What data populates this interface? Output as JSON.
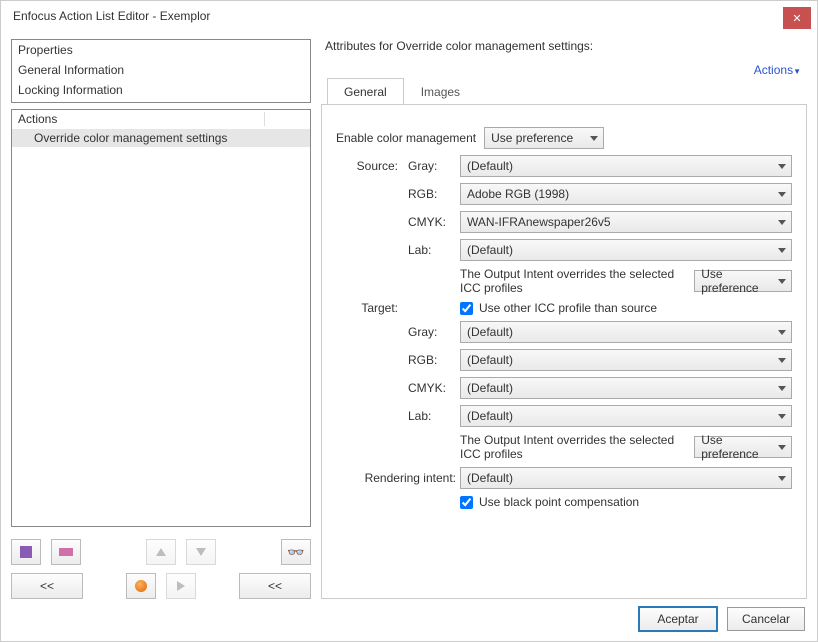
{
  "window": {
    "title": "Enfocus Action List Editor - Exemplor"
  },
  "left": {
    "list1": {
      "items": [
        "Properties",
        "General Information",
        "Locking Information"
      ]
    },
    "list2": {
      "header": "Actions",
      "items": [
        "Override color management settings"
      ]
    }
  },
  "right": {
    "title": "Attributes for Override color management settings:",
    "actions_link": "Actions",
    "tabs": {
      "general": "General",
      "images": "Images"
    },
    "form": {
      "enable_label": "Enable color management",
      "enable_value": "Use preference",
      "source_label": "Source:",
      "target_label": "Target:",
      "rendering_label": "Rendering intent:",
      "sub": {
        "gray": "Gray:",
        "rgb": "RGB:",
        "cmyk": "CMYK:",
        "lab": "Lab:"
      },
      "source": {
        "gray": "(Default)",
        "rgb": "Adobe RGB (1998)",
        "cmyk": "WAN-IFRAnewspaper26v5",
        "lab": "(Default)"
      },
      "output_intent_text": "The Output Intent overrides the selected ICC profiles",
      "output_intent_value_src": "Use preference",
      "use_other_label": "Use other ICC profile than source",
      "target": {
        "gray": "(Default)",
        "rgb": "(Default)",
        "cmyk": "(Default)",
        "lab": "(Default)"
      },
      "output_intent_value_tgt": "Use preference",
      "rendering_value": "(Default)",
      "black_point_label": "Use black point compensation"
    }
  },
  "toolbar": {
    "back": "<<",
    "back2": "<<",
    "back3": "<<"
  },
  "footer": {
    "ok": "Aceptar",
    "cancel": "Cancelar"
  }
}
